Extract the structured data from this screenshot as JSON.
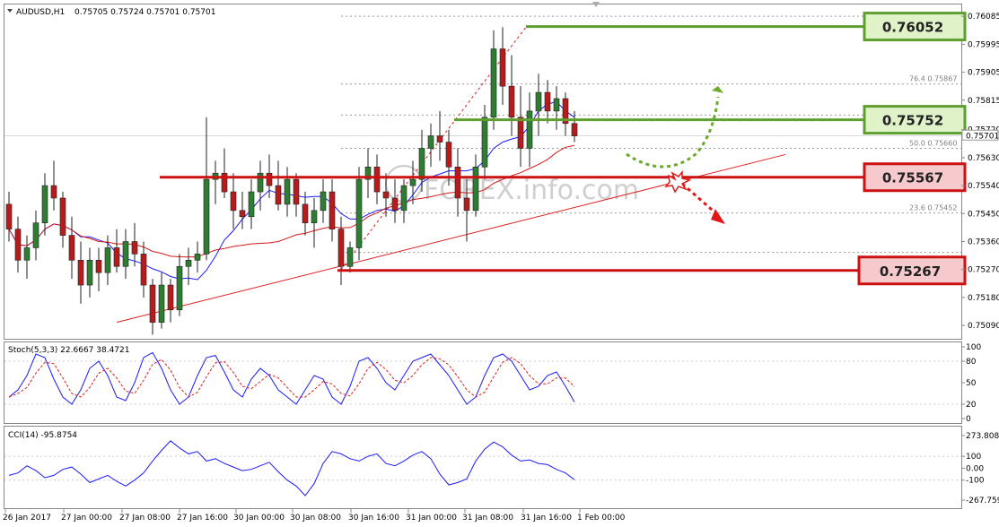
{
  "header": {
    "symbol_label": "AUDUSD,H1",
    "ohlc_label": "0.75705 0.75724 0.75701 0.75701"
  },
  "watermark": "FOREX.info.com",
  "price_axis": {
    "ticks": [
      "0.76085",
      "0.75995",
      "0.75905",
      "0.75815",
      "0.75720",
      "0.75630",
      "0.75540",
      "0.75450",
      "0.75360",
      "0.75270",
      "0.75180",
      "0.75090"
    ],
    "current": "0.75701"
  },
  "time_axis": {
    "labels": [
      "26 Jan 2017",
      "27 Jan 00:00",
      "27 Jan 08:00",
      "27 Jan 16:00",
      "30 Jan 00:00",
      "30 Jan 08:00",
      "30 Jan 16:00",
      "31 Jan 00:00",
      "31 Jan 08:00",
      "31 Jan 16:00",
      "1 Feb 00:00"
    ]
  },
  "levels": [
    {
      "value": "0.76052",
      "kind": "resistance",
      "color": "#5f9f32",
      "fill": "#dff2c8"
    },
    {
      "value": "0.75752",
      "kind": "resistance",
      "color": "#5f9f32",
      "fill": "#dff2c8"
    },
    {
      "value": "0.75567",
      "kind": "support",
      "color": "#cc1111",
      "fill": "#f6c9cc"
    },
    {
      "value": "0.75267",
      "kind": "support",
      "color": "#cc1111",
      "fill": "#f6c9cc"
    }
  ],
  "fib_labels": [
    {
      "text": "76.4  0.75867",
      "value": 0.75867
    },
    {
      "text": "50.0  0.75660",
      "value": 0.7566
    },
    {
      "text": "23.6  0.75452",
      "value": 0.75452
    }
  ],
  "colors": {
    "bull": "#2e7d32",
    "bear": "#b71c1c",
    "ma_fast": "#1a1aff",
    "ma_slow": "#d81818",
    "stoch_main": "#1a1aff",
    "stoch_signal": "#e02020",
    "cci": "#1a1aff",
    "trend": "#e02020"
  },
  "stoch_panel": {
    "title": "Stoch(5,3,3) 22.6667 38.4721",
    "ticks": [
      "100",
      "80",
      "50",
      "20",
      "0"
    ]
  },
  "cci_panel": {
    "title": "CCI(14) -95.8754",
    "ticks": [
      "273.8085",
      "100",
      "0.00",
      "-100",
      "-267.759"
    ]
  },
  "chart_data": {
    "type": "candlestick",
    "symbol": "AUDUSD",
    "timeframe": "H1",
    "ylim": [
      0.7505,
      0.7612
    ],
    "candles": [
      [
        0.7548,
        0.7552,
        0.7536,
        0.754
      ],
      [
        0.754,
        0.7544,
        0.7526,
        0.753
      ],
      [
        0.753,
        0.7538,
        0.7524,
        0.7534
      ],
      [
        0.7534,
        0.7546,
        0.753,
        0.7542
      ],
      [
        0.7542,
        0.7558,
        0.7538,
        0.7554
      ],
      [
        0.7554,
        0.7562,
        0.7546,
        0.755
      ],
      [
        0.755,
        0.7552,
        0.7534,
        0.7538
      ],
      [
        0.7538,
        0.7544,
        0.7524,
        0.753
      ],
      [
        0.753,
        0.7536,
        0.7516,
        0.7522
      ],
      [
        0.7522,
        0.7534,
        0.7518,
        0.753
      ],
      [
        0.753,
        0.7534,
        0.752,
        0.7526
      ],
      [
        0.7526,
        0.7538,
        0.7522,
        0.7534
      ],
      [
        0.7534,
        0.754,
        0.7526,
        0.7528
      ],
      [
        0.7528,
        0.754,
        0.7524,
        0.7536
      ],
      [
        0.7536,
        0.7542,
        0.7528,
        0.7532
      ],
      [
        0.7532,
        0.7536,
        0.7518,
        0.7522
      ],
      [
        0.7522,
        0.7524,
        0.7506,
        0.751
      ],
      [
        0.751,
        0.7526,
        0.7508,
        0.7522
      ],
      [
        0.7522,
        0.7524,
        0.751,
        0.7514
      ],
      [
        0.7514,
        0.7532,
        0.7512,
        0.7528
      ],
      [
        0.7528,
        0.7534,
        0.7522,
        0.753
      ],
      [
        0.753,
        0.7536,
        0.7526,
        0.7532
      ],
      [
        0.7532,
        0.7576,
        0.753,
        0.7556
      ],
      [
        0.7556,
        0.7562,
        0.7548,
        0.7558
      ],
      [
        0.7558,
        0.7566,
        0.755,
        0.7552
      ],
      [
        0.7552,
        0.7558,
        0.754,
        0.7546
      ],
      [
        0.7546,
        0.7552,
        0.754,
        0.7544
      ],
      [
        0.7544,
        0.7556,
        0.754,
        0.7552
      ],
      [
        0.7552,
        0.7562,
        0.7546,
        0.7558
      ],
      [
        0.7558,
        0.7564,
        0.755,
        0.7554
      ],
      [
        0.7554,
        0.7562,
        0.7546,
        0.7548
      ],
      [
        0.7548,
        0.756,
        0.7544,
        0.7556
      ],
      [
        0.7556,
        0.7558,
        0.7544,
        0.7548
      ],
      [
        0.7548,
        0.7552,
        0.7538,
        0.7542
      ],
      [
        0.7542,
        0.755,
        0.7534,
        0.7546
      ],
      [
        0.7546,
        0.7556,
        0.7542,
        0.7552
      ],
      [
        0.7552,
        0.7556,
        0.7536,
        0.754
      ],
      [
        0.754,
        0.7544,
        0.7522,
        0.7528
      ],
      [
        0.7528,
        0.7536,
        0.7526,
        0.7534
      ],
      [
        0.7534,
        0.756,
        0.753,
        0.7556
      ],
      [
        0.7556,
        0.7566,
        0.755,
        0.756
      ],
      [
        0.756,
        0.7564,
        0.7548,
        0.7552
      ],
      [
        0.7552,
        0.7558,
        0.7544,
        0.755
      ],
      [
        0.755,
        0.7556,
        0.7542,
        0.7546
      ],
      [
        0.7546,
        0.7556,
        0.7542,
        0.7554
      ],
      [
        0.7554,
        0.7562,
        0.7548,
        0.7556
      ],
      [
        0.7556,
        0.7572,
        0.7552,
        0.7566
      ],
      [
        0.7566,
        0.7574,
        0.756,
        0.757
      ],
      [
        0.757,
        0.7578,
        0.7562,
        0.7568
      ],
      [
        0.7568,
        0.7572,
        0.7554,
        0.756
      ],
      [
        0.756,
        0.7566,
        0.7544,
        0.755
      ],
      [
        0.755,
        0.7556,
        0.7536,
        0.7546
      ],
      [
        0.7546,
        0.7564,
        0.7544,
        0.756
      ],
      [
        0.756,
        0.758,
        0.7556,
        0.7576
      ],
      [
        0.7576,
        0.7604,
        0.7572,
        0.7598
      ],
      [
        0.7598,
        0.7605,
        0.758,
        0.7586
      ],
      [
        0.7586,
        0.7596,
        0.757,
        0.7576
      ],
      [
        0.7576,
        0.7586,
        0.756,
        0.7566
      ],
      [
        0.7566,
        0.7584,
        0.756,
        0.7578
      ],
      [
        0.7578,
        0.759,
        0.757,
        0.7584
      ],
      [
        0.7584,
        0.7588,
        0.7574,
        0.7578
      ],
      [
        0.7578,
        0.7586,
        0.7572,
        0.7582
      ],
      [
        0.7582,
        0.7584,
        0.757,
        0.7574
      ],
      [
        0.7574,
        0.7578,
        0.7568,
        0.757
      ]
    ],
    "levels": [
      0.76052,
      0.75752,
      0.75567,
      0.75267
    ],
    "fibonacci": {
      "23.6": 0.75452,
      "50.0": 0.7566,
      "76.4": 0.75867
    },
    "stochastic": {
      "params": "5,3,3",
      "main": 22.6667,
      "signal": 38.4721
    },
    "cci": {
      "period": 14,
      "value": -95.8754
    }
  }
}
